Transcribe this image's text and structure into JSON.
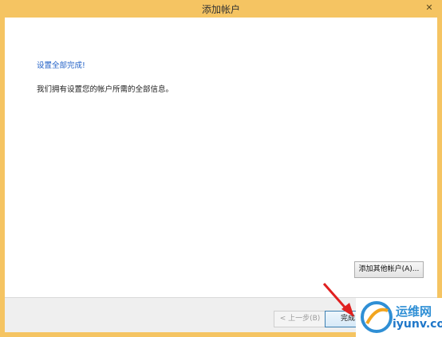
{
  "window": {
    "title": "添加帐户"
  },
  "content": {
    "heading": "设置全部完成!",
    "description": "我们拥有设置您的帐户所需的全部信息。"
  },
  "buttons": {
    "add_other": "添加其他帐户(A)...",
    "back": "< 上一步(B)",
    "finish": "完成",
    "close": "✕"
  },
  "watermark": {
    "chinese": "运维网",
    "domain": "iyunv.com"
  },
  "colors": {
    "titlebar": "#f5c462",
    "heading": "#1f5fc6",
    "arrow": "#e02020"
  }
}
